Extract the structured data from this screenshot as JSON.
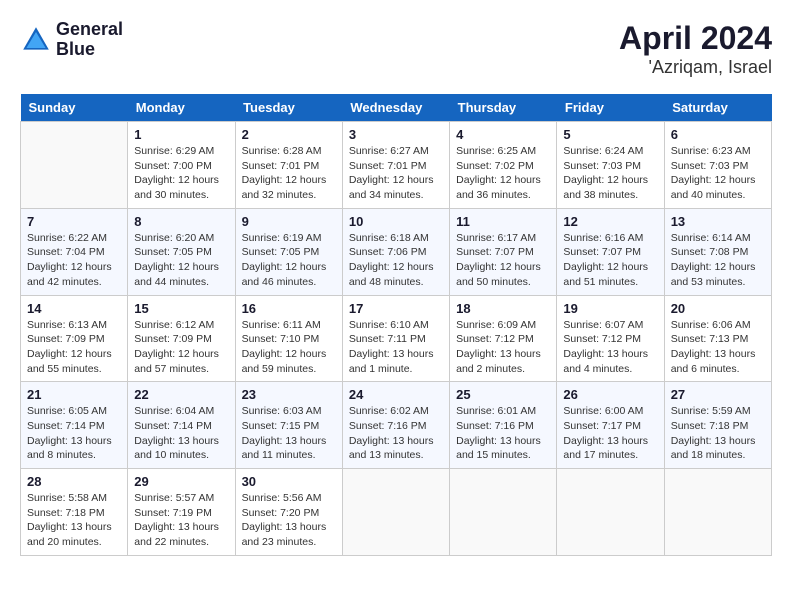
{
  "header": {
    "logo_line1": "General",
    "logo_line2": "Blue",
    "month_year": "April 2024",
    "location": "'Azriqam, Israel"
  },
  "days_of_week": [
    "Sunday",
    "Monday",
    "Tuesday",
    "Wednesday",
    "Thursday",
    "Friday",
    "Saturday"
  ],
  "weeks": [
    [
      {
        "num": "",
        "empty": true
      },
      {
        "num": "1",
        "sunrise": "6:29 AM",
        "sunset": "7:00 PM",
        "daylight": "12 hours and 30 minutes."
      },
      {
        "num": "2",
        "sunrise": "6:28 AM",
        "sunset": "7:01 PM",
        "daylight": "12 hours and 32 minutes."
      },
      {
        "num": "3",
        "sunrise": "6:27 AM",
        "sunset": "7:01 PM",
        "daylight": "12 hours and 34 minutes."
      },
      {
        "num": "4",
        "sunrise": "6:25 AM",
        "sunset": "7:02 PM",
        "daylight": "12 hours and 36 minutes."
      },
      {
        "num": "5",
        "sunrise": "6:24 AM",
        "sunset": "7:03 PM",
        "daylight": "12 hours and 38 minutes."
      },
      {
        "num": "6",
        "sunrise": "6:23 AM",
        "sunset": "7:03 PM",
        "daylight": "12 hours and 40 minutes."
      }
    ],
    [
      {
        "num": "7",
        "sunrise": "6:22 AM",
        "sunset": "7:04 PM",
        "daylight": "12 hours and 42 minutes."
      },
      {
        "num": "8",
        "sunrise": "6:20 AM",
        "sunset": "7:05 PM",
        "daylight": "12 hours and 44 minutes."
      },
      {
        "num": "9",
        "sunrise": "6:19 AM",
        "sunset": "7:05 PM",
        "daylight": "12 hours and 46 minutes."
      },
      {
        "num": "10",
        "sunrise": "6:18 AM",
        "sunset": "7:06 PM",
        "daylight": "12 hours and 48 minutes."
      },
      {
        "num": "11",
        "sunrise": "6:17 AM",
        "sunset": "7:07 PM",
        "daylight": "12 hours and 50 minutes."
      },
      {
        "num": "12",
        "sunrise": "6:16 AM",
        "sunset": "7:07 PM",
        "daylight": "12 hours and 51 minutes."
      },
      {
        "num": "13",
        "sunrise": "6:14 AM",
        "sunset": "7:08 PM",
        "daylight": "12 hours and 53 minutes."
      }
    ],
    [
      {
        "num": "14",
        "sunrise": "6:13 AM",
        "sunset": "7:09 PM",
        "daylight": "12 hours and 55 minutes."
      },
      {
        "num": "15",
        "sunrise": "6:12 AM",
        "sunset": "7:09 PM",
        "daylight": "12 hours and 57 minutes."
      },
      {
        "num": "16",
        "sunrise": "6:11 AM",
        "sunset": "7:10 PM",
        "daylight": "12 hours and 59 minutes."
      },
      {
        "num": "17",
        "sunrise": "6:10 AM",
        "sunset": "7:11 PM",
        "daylight": "13 hours and 1 minute."
      },
      {
        "num": "18",
        "sunrise": "6:09 AM",
        "sunset": "7:12 PM",
        "daylight": "13 hours and 2 minutes."
      },
      {
        "num": "19",
        "sunrise": "6:07 AM",
        "sunset": "7:12 PM",
        "daylight": "13 hours and 4 minutes."
      },
      {
        "num": "20",
        "sunrise": "6:06 AM",
        "sunset": "7:13 PM",
        "daylight": "13 hours and 6 minutes."
      }
    ],
    [
      {
        "num": "21",
        "sunrise": "6:05 AM",
        "sunset": "7:14 PM",
        "daylight": "13 hours and 8 minutes."
      },
      {
        "num": "22",
        "sunrise": "6:04 AM",
        "sunset": "7:14 PM",
        "daylight": "13 hours and 10 minutes."
      },
      {
        "num": "23",
        "sunrise": "6:03 AM",
        "sunset": "7:15 PM",
        "daylight": "13 hours and 11 minutes."
      },
      {
        "num": "24",
        "sunrise": "6:02 AM",
        "sunset": "7:16 PM",
        "daylight": "13 hours and 13 minutes."
      },
      {
        "num": "25",
        "sunrise": "6:01 AM",
        "sunset": "7:16 PM",
        "daylight": "13 hours and 15 minutes."
      },
      {
        "num": "26",
        "sunrise": "6:00 AM",
        "sunset": "7:17 PM",
        "daylight": "13 hours and 17 minutes."
      },
      {
        "num": "27",
        "sunrise": "5:59 AM",
        "sunset": "7:18 PM",
        "daylight": "13 hours and 18 minutes."
      }
    ],
    [
      {
        "num": "28",
        "sunrise": "5:58 AM",
        "sunset": "7:18 PM",
        "daylight": "13 hours and 20 minutes."
      },
      {
        "num": "29",
        "sunrise": "5:57 AM",
        "sunset": "7:19 PM",
        "daylight": "13 hours and 22 minutes."
      },
      {
        "num": "30",
        "sunrise": "5:56 AM",
        "sunset": "7:20 PM",
        "daylight": "13 hours and 23 minutes."
      },
      {
        "num": "",
        "empty": true
      },
      {
        "num": "",
        "empty": true
      },
      {
        "num": "",
        "empty": true
      },
      {
        "num": "",
        "empty": true
      }
    ]
  ],
  "labels": {
    "sunrise": "Sunrise:",
    "sunset": "Sunset:",
    "daylight": "Daylight:"
  }
}
